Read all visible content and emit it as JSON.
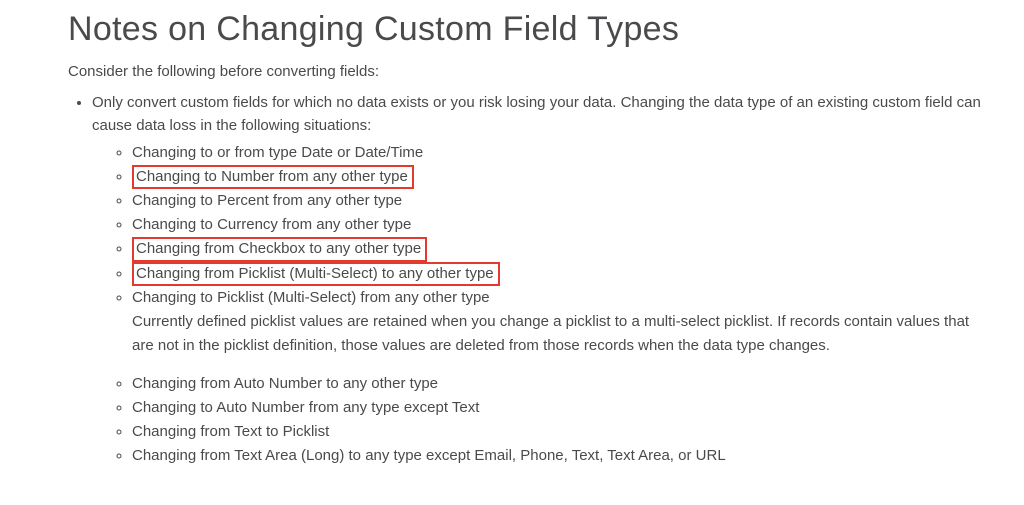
{
  "title": "Notes on Changing Custom Field Types",
  "intro": "Consider the following before converting fields:",
  "mainBullet": "Only convert custom fields for which no data exists or you risk losing your data. Changing the data type of an existing custom field can cause data loss in the following situations:",
  "group1": {
    "i0": "Changing to or from type Date or Date/Time",
    "i1": "Changing to Number from any other type",
    "i2": "Changing to Percent from any other type",
    "i3": "Changing to Currency from any other type",
    "i4": "Changing from Checkbox to any other type",
    "i5": "Changing from Picklist (Multi-Select) to any other type",
    "i6": "Changing to Picklist (Multi-Select) from any other type",
    "i6desc": "Currently defined picklist values are retained when you change a picklist to a multi-select picklist. If records contain values that are not in the picklist definition, those values are deleted from those records when the data type changes."
  },
  "group2": {
    "i0": "Changing from Auto Number to any other type",
    "i1": "Changing to Auto Number from any type except Text",
    "i2": "Changing from Text to Picklist",
    "i3": "Changing from Text Area (Long) to any type except Email, Phone, Text, Text Area, or URL"
  }
}
